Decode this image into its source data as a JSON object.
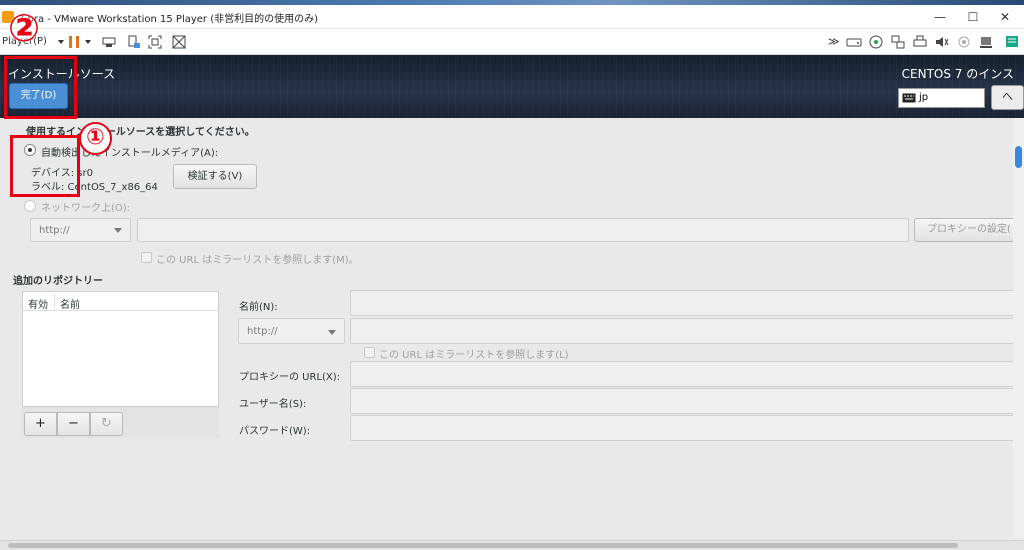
{
  "window": {
    "title": "7 pra - VMware Workstation 15 Player (非営利目的の使用のみ)",
    "minimize": "—",
    "maximize": "☐",
    "close": "✕"
  },
  "toolbar": {
    "player_menu": "Player(P)",
    "icons": [
      "pause-icon",
      "send-keys-icon",
      "vm-settings-icon",
      "unity-icon",
      "fullscreen-icon",
      "disconnect-icon"
    ],
    "right_icons": [
      "more-icon",
      "hdd-icon",
      "cd-icon",
      "network-icon",
      "printer-icon",
      "sound-icon",
      "usb-icon",
      "display-icon",
      "message-icon"
    ]
  },
  "header": {
    "title": "インストールソース",
    "done_button": "完了(D)",
    "product": "CENTOS 7 のインス",
    "keyboard_value": "jp",
    "help_label": "へ"
  },
  "source": {
    "prompt": "使用するインストールソースを選択してください。",
    "auto_media_label": "自動検出したインストールメディア(A):",
    "device_label": "デバイス: sr0",
    "label_label": "ラベル: CentOS_7_x86_64",
    "verify_button": "検証する(V)",
    "network_label": "ネットワーク上(O):",
    "protocol": "http://",
    "proxy_button": "プロキシーの設定(",
    "mirror_label": "この URL はミラーリストを参照します(M)。"
  },
  "repos": {
    "heading": "追加のリポジトリー",
    "col_enabled": "有効",
    "col_name": "名前",
    "add": "+",
    "remove": "−",
    "refresh": "↻",
    "name_label": "名前(N):",
    "protocol": "http://",
    "mirror_label": "この URL はミラーリストを参照します(L)",
    "proxy_label": "プロキシーの URL(X):",
    "user_label": "ユーザー名(S):",
    "password_label": "パスワード(W):"
  },
  "annotations": {
    "one": "①",
    "two": "②"
  },
  "colors": {
    "header_bg": "#1d2433",
    "done_button": "#4a8fd5",
    "annotation": "#e60012",
    "accent": "#3e87d8"
  }
}
